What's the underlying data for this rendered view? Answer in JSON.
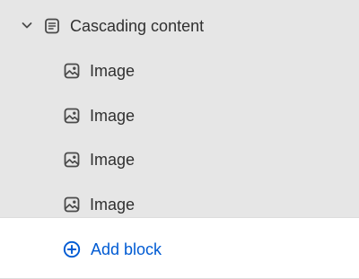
{
  "colors": {
    "panel_background": "#e6e6e6",
    "text": "#303030",
    "icon": "#4a4a4a",
    "accent": "#005bd3"
  },
  "section": {
    "label": "Cascading content",
    "icon": "section-icon",
    "expanded": true
  },
  "blocks": [
    {
      "label": "Image",
      "icon": "image-icon"
    },
    {
      "label": "Image",
      "icon": "image-icon"
    },
    {
      "label": "Image",
      "icon": "image-icon"
    },
    {
      "label": "Image",
      "icon": "image-icon"
    }
  ],
  "add_block": {
    "label": "Add block",
    "icon": "plus-circle-icon"
  }
}
